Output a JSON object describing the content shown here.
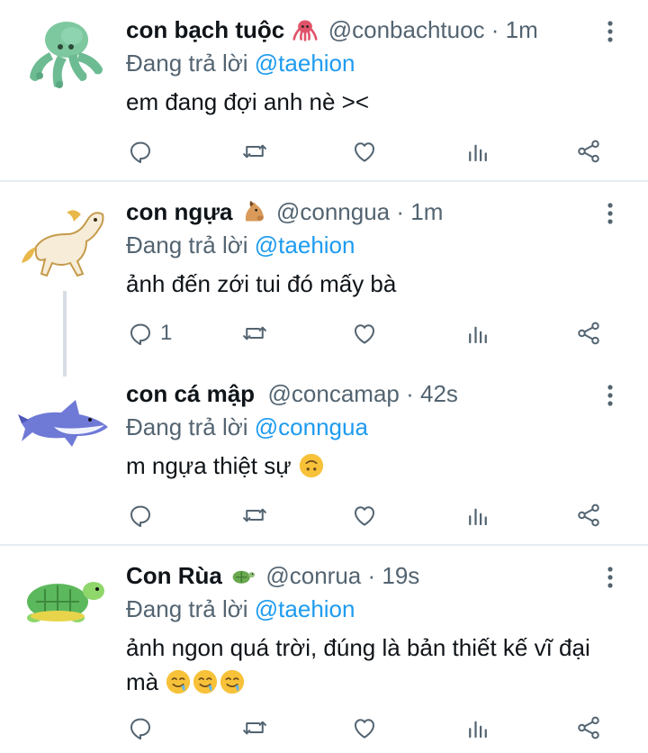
{
  "colors": {
    "text": "#0f1419",
    "secondary": "#536471",
    "link": "#1d9bf0",
    "divider": "#e6ecf0"
  },
  "replies": [
    {
      "name": "con bạch tuộc",
      "name_emoji": "octopus-emoji",
      "handle": "@conbachtuoc",
      "sep": " · ",
      "time": "1m",
      "replying_prefix": "Đang trả lời ",
      "replying_to": "@taehion",
      "text": "em đang đợi anh nè ><",
      "reply_count": ""
    },
    {
      "name": "con ngựa",
      "name_emoji": "horse-face-emoji",
      "handle": "@conngua",
      "sep": " · ",
      "time": "1m",
      "replying_prefix": "Đang trả lời ",
      "replying_to": "@taehion",
      "text": "ảnh đến zới tui đó mấy bà",
      "reply_count": "1"
    },
    {
      "name": "con cá mập",
      "name_emoji": "",
      "handle": "@concamap",
      "sep": " · ",
      "time": "42s",
      "replying_prefix": "Đang trả lời ",
      "replying_to": "@conngua",
      "text": "m ngựa thiệt sự",
      "text_emoji": "upside-down-face-emoji",
      "reply_count": ""
    },
    {
      "name": "Con Rùa",
      "name_emoji": "turtle-emoji",
      "handle": "@conrua",
      "sep": " · ",
      "time": "19s",
      "replying_prefix": "Đang trả lời ",
      "replying_to": "@taehion",
      "text_line1": "ảnh ngon quá trời, đúng là bản thiết kế vĩ đại",
      "text_line2": "mà",
      "text_emoji": "drooling-face-emoji",
      "reply_count": ""
    }
  ],
  "icons": [
    "reply-icon",
    "retweet-icon",
    "like-icon",
    "analytics-icon",
    "share-icon",
    "more-icon"
  ]
}
